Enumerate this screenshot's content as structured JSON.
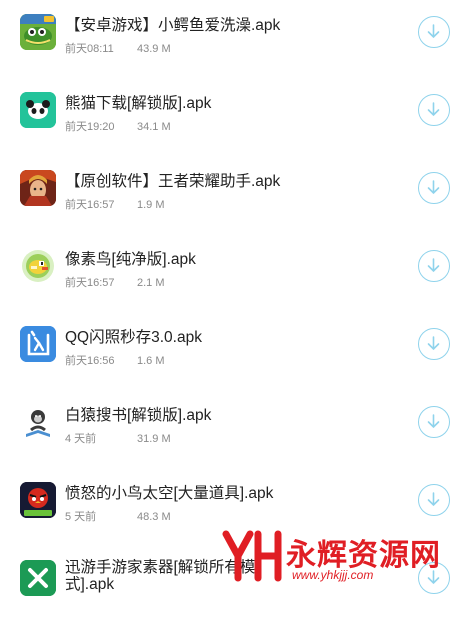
{
  "files": [
    {
      "title": "【安卓游戏】小鳄鱼爱洗澡.apk",
      "time": "前天08:11",
      "size": "43.9 M",
      "icon": "crocodile-game-icon"
    },
    {
      "title": "熊猫下载[解锁版].apk",
      "time": "前天19:20",
      "size": "34.1 M",
      "icon": "panda-icon"
    },
    {
      "title": "【原创软件】王者荣耀助手.apk",
      "time": "前天16:57",
      "size": "1.9 M",
      "icon": "hero-character-icon"
    },
    {
      "title": "像素鸟[纯净版].apk",
      "time": "前天16:57",
      "size": "2.1 M",
      "icon": "pixel-bird-icon"
    },
    {
      "title": "QQ闪照秒存3.0.apk",
      "time": "前天16:56",
      "size": "1.6 M",
      "icon": "flash-character-icon"
    },
    {
      "title": "白猿搜书[解锁版].apk",
      "time": "4 天前",
      "size": "31.9 M",
      "icon": "ape-reading-icon"
    },
    {
      "title": "愤怒的小鸟太空[大量道具].apk",
      "time": "5 天前",
      "size": "48.3 M",
      "icon": "angry-birds-space-icon"
    },
    {
      "title": "迅游手游家素器[解锁所有模式].apk",
      "time": "",
      "size": "",
      "icon": "green-x-icon"
    }
  ],
  "watermark": {
    "text": "永辉资源网",
    "url": "www.yhkjjj.com",
    "logo": "YH"
  },
  "colors": {
    "download_ring": "#8fd3ec",
    "watermark": "#e01e24"
  }
}
